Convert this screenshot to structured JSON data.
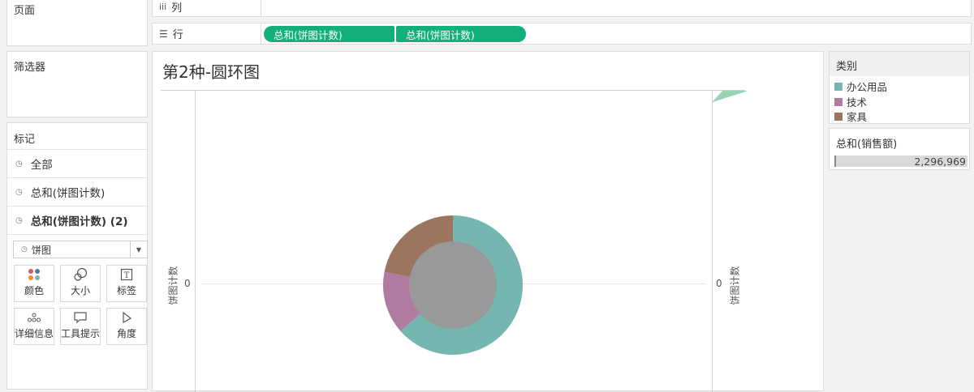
{
  "left": {
    "pages_title": "页面",
    "filters_title": "筛选器",
    "marks_title": "标记",
    "mark_rows": [
      {
        "label": "全部",
        "bold": false
      },
      {
        "label": "总和(饼图计数)",
        "bold": false
      },
      {
        "label": "总和(饼图计数) (2)",
        "bold": true
      }
    ],
    "mark_type": "饼图",
    "mark_buttons": [
      {
        "label": "颜色",
        "icon": "color-dots-icon"
      },
      {
        "label": "大小",
        "icon": "size-icon"
      },
      {
        "label": "标签",
        "icon": "label-icon"
      },
      {
        "label": "详细信息",
        "icon": "detail-icon"
      },
      {
        "label": "工具提示",
        "icon": "tooltip-icon"
      },
      {
        "label": "角度",
        "icon": "angle-icon"
      }
    ]
  },
  "shelves": {
    "columns_label": "列",
    "rows_label": "行",
    "row_pills": [
      "总和(饼图计数)",
      "总和(饼图计数)"
    ],
    "pill_color": "#11b07a"
  },
  "sheet": {
    "title": "第2种-圆环图",
    "left_axis_label": "饼图计数",
    "right_axis_label": "饼图计数",
    "left_tick": "0",
    "right_tick": "0"
  },
  "legend": {
    "title": "类别",
    "items": [
      {
        "label": "办公用品",
        "color": "#76b6b1"
      },
      {
        "label": "技术",
        "color": "#b07aa1"
      },
      {
        "label": "家具",
        "color": "#9c755f"
      }
    ]
  },
  "sales": {
    "title": "总和(销售额)",
    "value": "2,296,969"
  },
  "chart_data": {
    "type": "pie",
    "title": "第2种-圆环图",
    "categories": [
      "办公用品",
      "技术",
      "家具"
    ],
    "values": [
      63.5,
      14.5,
      22.0
    ],
    "unit": "percent",
    "colors": [
      "#76b6b1",
      "#b07aa1",
      "#9c755f"
    ],
    "center_color": "#999999"
  }
}
